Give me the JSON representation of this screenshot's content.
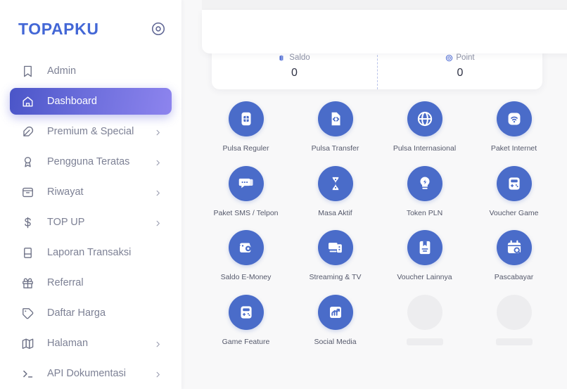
{
  "brand": {
    "title": "TOPAPKU",
    "icon": "target-circle-icon"
  },
  "sidebar": {
    "items": [
      {
        "label": "Admin",
        "icon": "bookmark-icon",
        "has_caret": false,
        "active": false
      },
      {
        "label": "Dashboard",
        "icon": "home-icon",
        "has_caret": false,
        "active": true
      },
      {
        "label": "Premium & Special",
        "icon": "feather-icon",
        "has_caret": true,
        "active": false
      },
      {
        "label": "Pengguna Teratas",
        "icon": "award-icon",
        "has_caret": true,
        "active": false
      },
      {
        "label": "Riwayat",
        "icon": "archive-icon",
        "has_caret": true,
        "active": false
      },
      {
        "label": "TOP UP",
        "icon": "dollar-icon",
        "has_caret": true,
        "active": false
      },
      {
        "label": "Laporan Transaksi",
        "icon": "book-icon",
        "has_caret": false,
        "active": false
      },
      {
        "label": "Referral",
        "icon": "gift-icon",
        "has_caret": false,
        "active": false
      },
      {
        "label": "Daftar Harga",
        "icon": "tag-icon",
        "has_caret": false,
        "active": false
      },
      {
        "label": "Halaman",
        "icon": "map-icon",
        "has_caret": true,
        "active": false
      },
      {
        "label": "API Dokumentasi",
        "icon": "terminal-icon",
        "has_caret": true,
        "active": false
      }
    ]
  },
  "balance_card": {
    "columns": [
      {
        "label": "Saldo",
        "value": "0",
        "icon": "wallet-icon"
      },
      {
        "label": "Point",
        "value": "0",
        "icon": "coin-target-icon"
      }
    ]
  },
  "products": [
    {
      "label": "Pulsa Reguler",
      "icon": "sim-card-icon",
      "loading": false
    },
    {
      "label": "Pulsa Transfer",
      "icon": "code-file-icon",
      "loading": false
    },
    {
      "label": "Pulsa Internasional",
      "icon": "globe-icon",
      "loading": false
    },
    {
      "label": "Paket Internet",
      "icon": "wifi-icon",
      "loading": false
    },
    {
      "label": "Paket SMS / Telpon",
      "icon": "chat-bubble-icon",
      "loading": false
    },
    {
      "label": "Masa Aktif",
      "icon": "hourglass-icon",
      "loading": false
    },
    {
      "label": "Token PLN",
      "icon": "lightbulb-bolt-icon",
      "loading": false
    },
    {
      "label": "Voucher Game",
      "icon": "gamepad-icon",
      "loading": false
    },
    {
      "label": "Saldo E-Money",
      "icon": "wallet-card-icon",
      "loading": false
    },
    {
      "label": "Streaming & TV",
      "icon": "tv-device-icon",
      "loading": false
    },
    {
      "label": "Voucher Lainnya",
      "icon": "voucher-book-icon",
      "loading": false
    },
    {
      "label": "Pascabayar",
      "icon": "calendar-search-icon",
      "loading": false
    },
    {
      "label": "Game Feature",
      "icon": "gamepad-icon",
      "loading": false
    },
    {
      "label": "Social Media",
      "icon": "chart-growth-icon",
      "loading": false
    },
    {
      "label": "",
      "icon": "skeleton",
      "loading": true
    },
    {
      "label": "",
      "icon": "skeleton",
      "loading": true
    }
  ],
  "colors": {
    "brand_blue": "#4367d6",
    "active_gradient_start": "#4a55c8",
    "active_gradient_end": "#8d84ee",
    "tile_circle": "#4a6cc9",
    "page_bg": "#f8f8f9",
    "skeleton": "#ededef"
  }
}
